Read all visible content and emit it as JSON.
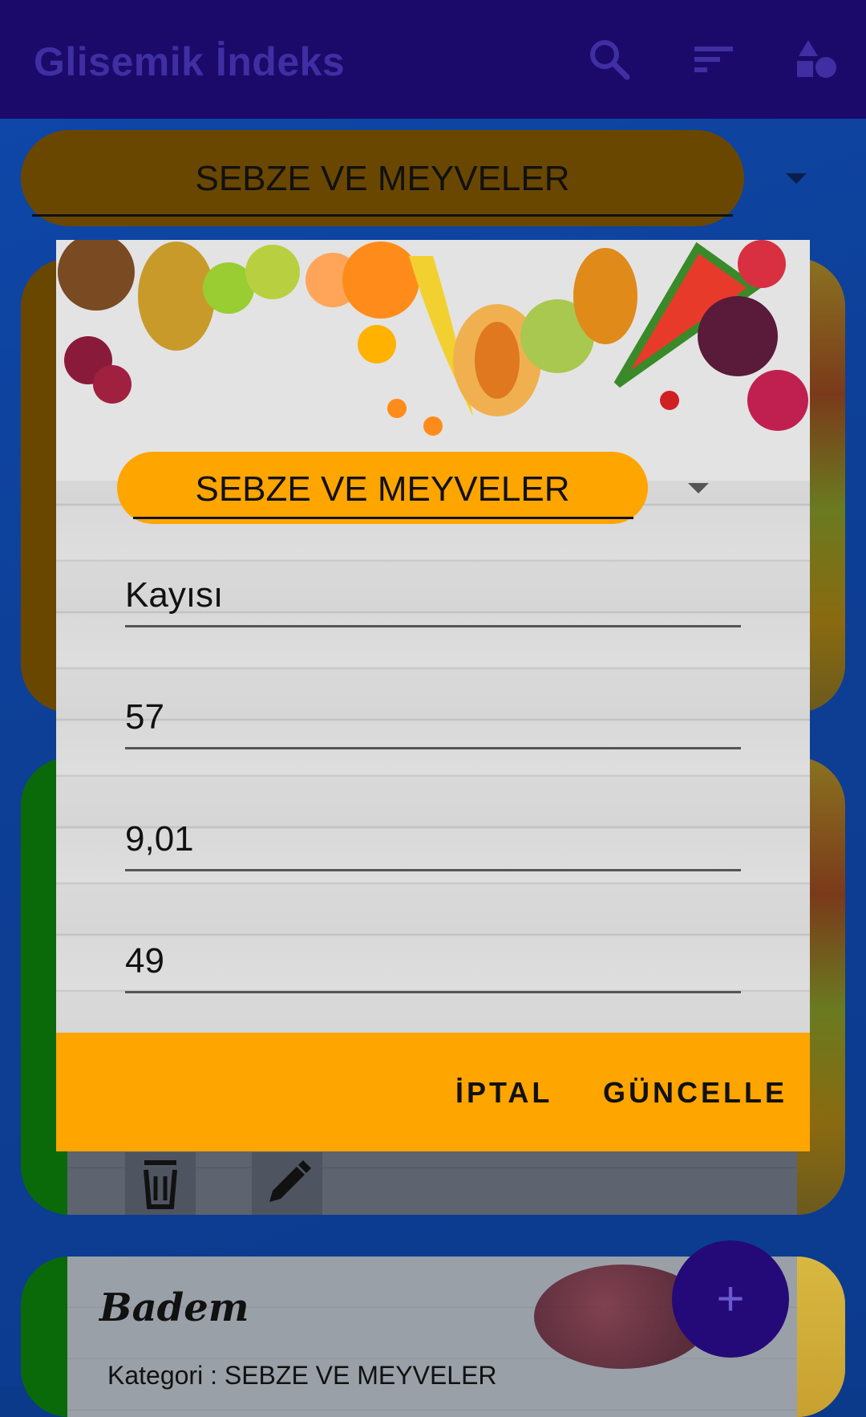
{
  "app_bar": {
    "title": "Glisemik İndeks",
    "icons": [
      "search-icon",
      "sort-icon",
      "category-shapes-icon"
    ]
  },
  "category_selector": {
    "selected": "SEBZE VE MEYVELER"
  },
  "list": {
    "items": [
      {
        "name": "",
        "stripe_color": "#6a4700"
      },
      {
        "name": "",
        "stripe_color": "#0a6a0a",
        "actions": [
          "delete-icon",
          "edit-icon"
        ]
      },
      {
        "name": "Badem",
        "category_line": "Kategori : SEBZE VE MEYVELER",
        "stripe_color": "#0a6a0a"
      }
    ]
  },
  "fab": {
    "label": "+"
  },
  "dialog": {
    "category": "SEBZE VE MEYVELER",
    "fields": [
      {
        "value": "Kayısı"
      },
      {
        "value": "57"
      },
      {
        "value": "9,01"
      },
      {
        "value": "49"
      }
    ],
    "cancel_label": "İPTAL",
    "update_label": "GÜNCELLE",
    "accent_color": "#ffa500"
  }
}
